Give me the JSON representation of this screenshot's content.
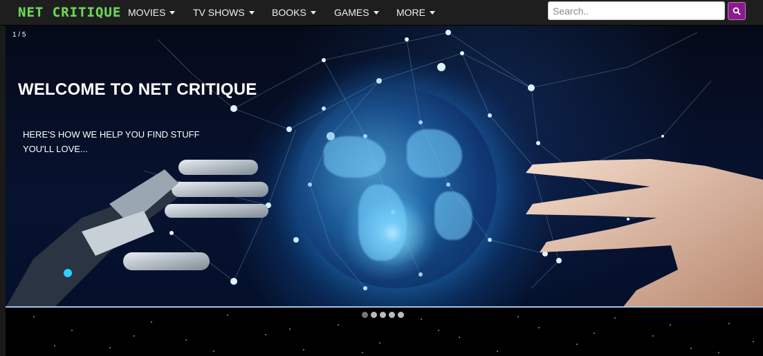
{
  "header": {
    "logo": "NET CRITIQUE",
    "nav": [
      {
        "label": "MOVIES"
      },
      {
        "label": "TV SHOWS"
      },
      {
        "label": "BOOKS"
      },
      {
        "label": "GAMES"
      },
      {
        "label": "MORE"
      }
    ],
    "search": {
      "placeholder": "Search..",
      "button_icon": "search-icon"
    }
  },
  "hero": {
    "slide_counter": "1 / 5",
    "title": "WELCOME TO NET CRITIQUE",
    "subtitle": "HERE'S HOW WE HELP YOU FIND STUFF YOU'LL LOVE...",
    "slide_count": 5,
    "active_slide": 1
  },
  "colors": {
    "logo": "#6fd45a",
    "nav_background": "#1e1e1e",
    "search_button": "#8a1b8a"
  }
}
